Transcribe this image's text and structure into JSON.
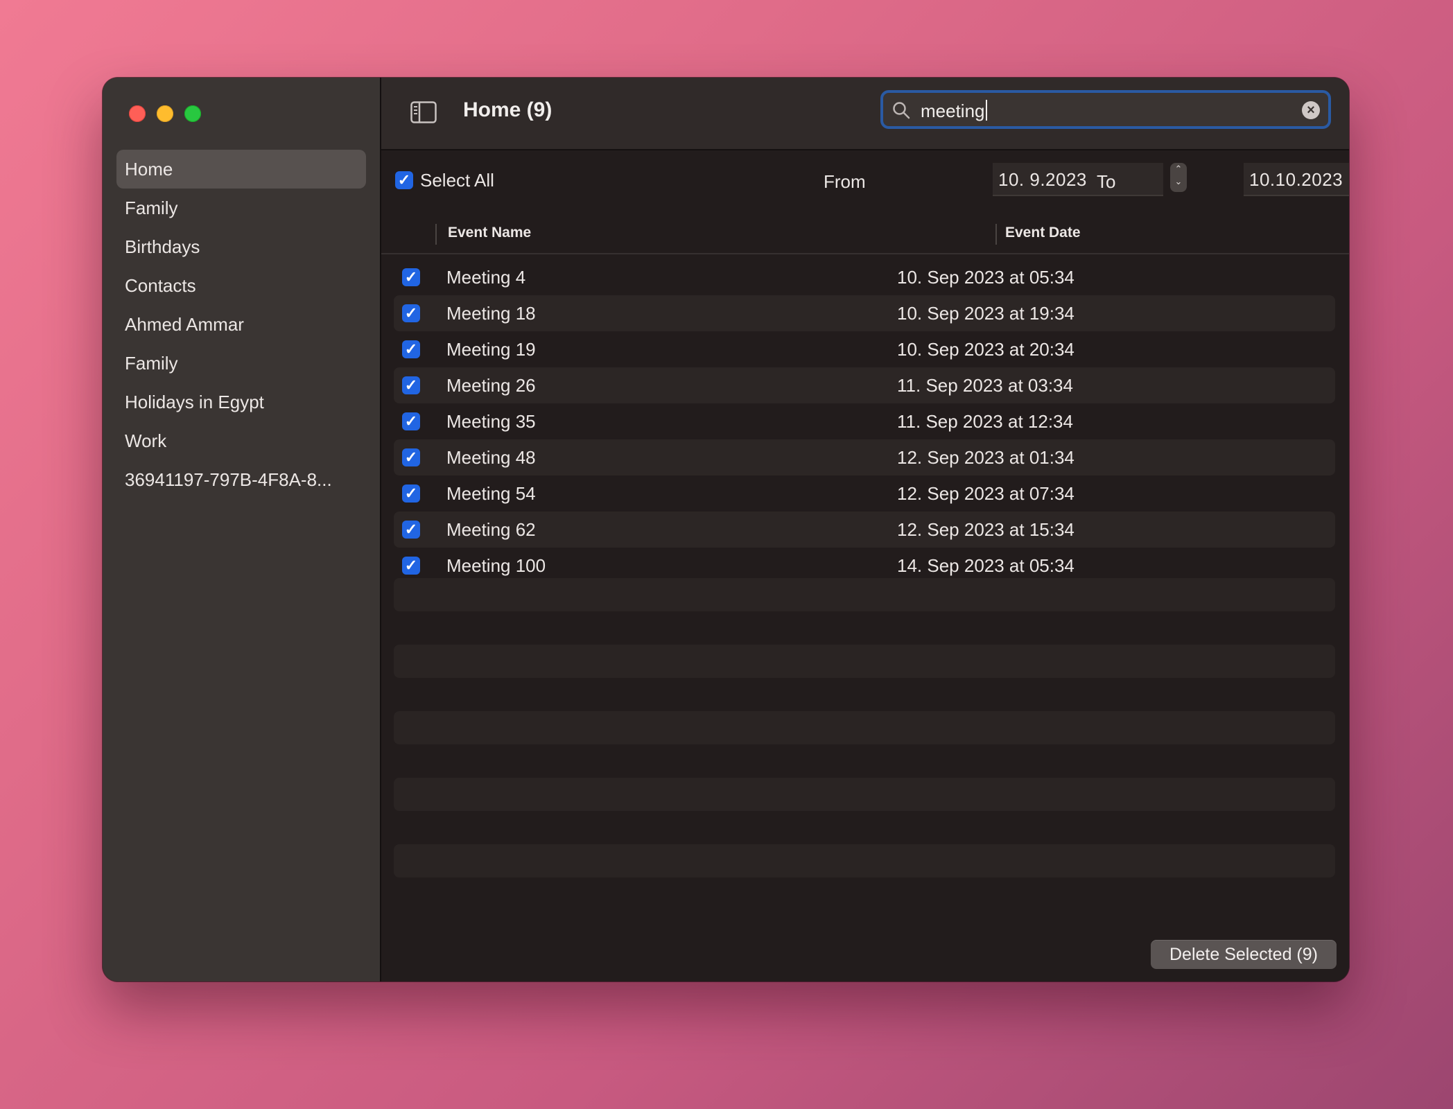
{
  "window": {
    "title": "Home (9)",
    "controls": [
      "close",
      "minimize",
      "zoom"
    ]
  },
  "sidebar": {
    "items": [
      {
        "label": "Home",
        "selected": true
      },
      {
        "label": "Family"
      },
      {
        "label": "Birthdays"
      },
      {
        "label": "Contacts"
      },
      {
        "label": "Ahmed Ammar"
      },
      {
        "label": "Family"
      },
      {
        "label": "Holidays in Egypt"
      },
      {
        "label": "Work"
      },
      {
        "label": "36941197-797B-4F8A-8..."
      }
    ]
  },
  "toolbar": {
    "sidebar_toggle_icon": "sidebar-icon",
    "search": {
      "value": "meeting",
      "icon": "search-icon",
      "clear_icon": "clear-icon"
    }
  },
  "filters": {
    "select_all_label": "Select All",
    "select_all_checked": true,
    "from_label": "From",
    "from_value": "10. 9.2023",
    "to_label": "To",
    "to_value": "10.10.2023"
  },
  "table": {
    "columns": [
      "Event Name",
      "Event Date"
    ],
    "rows": [
      {
        "name": "Meeting 4",
        "date": "10. Sep 2023 at 05:34",
        "checked": true
      },
      {
        "name": "Meeting 18",
        "date": "10. Sep 2023 at 19:34",
        "checked": true
      },
      {
        "name": "Meeting 19",
        "date": "10. Sep 2023 at 20:34",
        "checked": true
      },
      {
        "name": "Meeting 26",
        "date": "11. Sep 2023 at 03:34",
        "checked": true
      },
      {
        "name": "Meeting 35",
        "date": "11. Sep 2023 at 12:34",
        "checked": true
      },
      {
        "name": "Meeting 48",
        "date": "12. Sep 2023 at 01:34",
        "checked": true
      },
      {
        "name": "Meeting 54",
        "date": "12. Sep 2023 at 07:34",
        "checked": true
      },
      {
        "name": "Meeting 62",
        "date": "12. Sep 2023 at 15:34",
        "checked": true
      },
      {
        "name": "Meeting 100",
        "date": "14. Sep 2023 at 05:34",
        "checked": true
      }
    ]
  },
  "footer": {
    "delete_label": "Delete Selected (9)"
  },
  "colors": {
    "accent": "#2165e3",
    "search_focus": "#2a5aa3",
    "close": "#fe5f57",
    "minimize": "#febc2e",
    "zoom": "#28c840"
  }
}
